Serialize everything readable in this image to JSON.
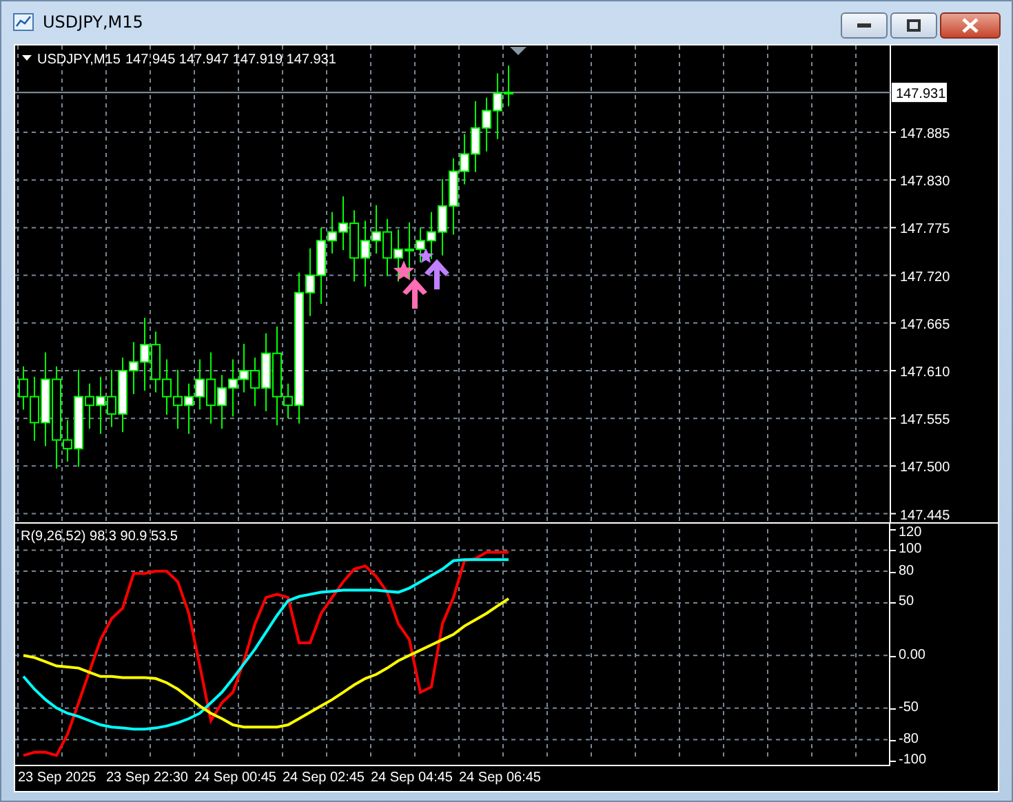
{
  "window": {
    "title": "USDJPY,M15"
  },
  "chart": {
    "symbol": "USDJPY,M15",
    "quote": "147.945 147.947 147.919 147.931",
    "current_price": "147.931",
    "price_axis": [
      "147.885",
      "147.830",
      "147.775",
      "147.720",
      "147.665",
      "147.610",
      "147.555",
      "147.500",
      "147.445"
    ]
  },
  "indicator": {
    "label": "R(9,26,52) 98.3 90.9 53.5",
    "chart_data": {
      "type": "line",
      "grid": true,
      "ylim": [
        -100,
        120
      ],
      "yticks": [
        120,
        100,
        80,
        50,
        {
          "value": 0,
          "label": "0.00"
        },
        -50,
        -80,
        -100
      ],
      "series": [
        {
          "color": "#ff0000",
          "values": [
            -95,
            -92,
            -92,
            -95,
            -75,
            -45,
            -15,
            15,
            35,
            45,
            78,
            78,
            80,
            80,
            70,
            40,
            -10,
            -62,
            -45,
            -35,
            -5,
            30,
            55,
            58,
            55,
            12,
            12,
            40,
            55,
            70,
            82,
            85,
            75,
            60,
            30,
            15,
            -35,
            -30,
            30,
            55,
            90,
            92,
            98,
            98,
            98
          ]
        },
        {
          "color": "#00ffff",
          "values": [
            -20,
            -32,
            -42,
            -50,
            -55,
            -58,
            -62,
            -66,
            -68,
            -69,
            -70,
            -70,
            -69,
            -67,
            -64,
            -60,
            -55,
            -45,
            -35,
            -22,
            -8,
            6,
            22,
            38,
            52,
            56,
            58,
            60,
            61,
            62,
            62,
            62,
            62,
            61,
            60,
            64,
            70,
            76,
            82,
            90,
            91,
            91,
            91,
            91,
            91
          ]
        },
        {
          "color": "#ffff00",
          "values": [
            0,
            -2,
            -6,
            -10,
            -11,
            -12,
            -16,
            -20,
            -20,
            -21,
            -21,
            -21,
            -22,
            -26,
            -32,
            -40,
            -48,
            -55,
            -60,
            -66,
            -68,
            -68,
            -68,
            -68,
            -66,
            -60,
            -54,
            -48,
            -42,
            -35,
            -28,
            -22,
            -18,
            -12,
            -5,
            0,
            5,
            10,
            15,
            20,
            28,
            34,
            40,
            47,
            54
          ]
        }
      ]
    }
  },
  "time_axis": [
    "23 Sep 2025",
    "23 Sep 22:30",
    "24 Sep 00:45",
    "24 Sep 02:45",
    "24 Sep 04:45",
    "24 Sep 06:45"
  ]
}
